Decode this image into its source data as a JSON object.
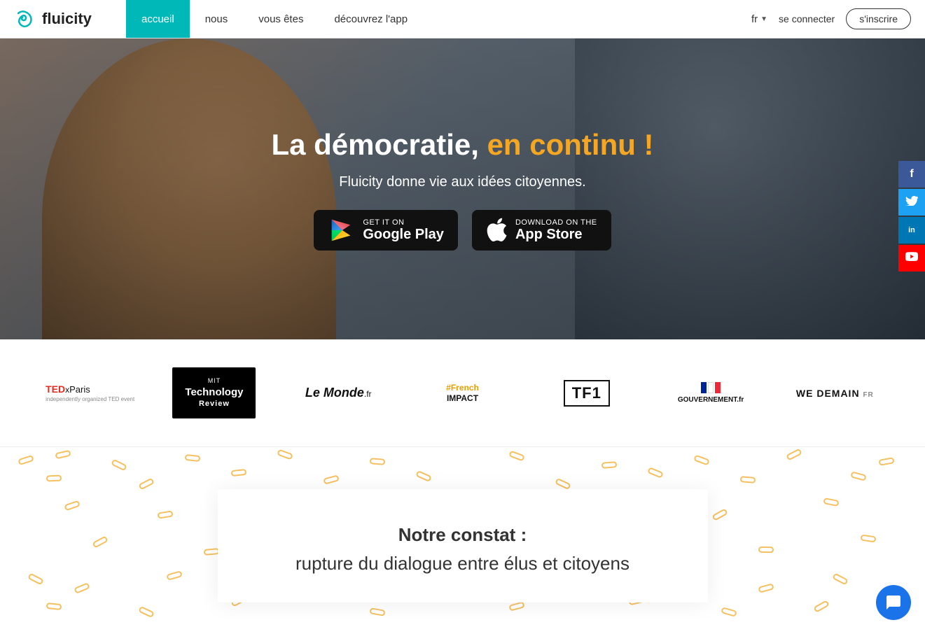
{
  "site": {
    "logo_text": "fluicity",
    "favicon_char": "F"
  },
  "navbar": {
    "links": [
      {
        "id": "accueil",
        "label": "accueil",
        "active": true
      },
      {
        "id": "nous",
        "label": "nous",
        "active": false
      },
      {
        "id": "vous-etes",
        "label": "vous êtes",
        "active": false
      },
      {
        "id": "decouvrez",
        "label": "découvrez l'app",
        "active": false
      }
    ],
    "lang": "fr",
    "lang_arrow": "▼",
    "connect_label": "se connecter",
    "register_label": "s'inscrire"
  },
  "hero": {
    "title_part1": "La démocratie, ",
    "title_highlight": "en continu !",
    "subtitle": "Fluicity donne vie aux idées citoyennes.",
    "google_play_top": "GET IT ON",
    "google_play_bottom": "Google Play",
    "app_store_top": "Download on the",
    "app_store_bottom": "App Store"
  },
  "social": {
    "facebook_char": "f",
    "twitter_char": "t",
    "linkedin_char": "in",
    "youtube_char": "▶"
  },
  "press": {
    "logos": [
      {
        "id": "tedx",
        "label": "TEDxParis",
        "type": "tedx"
      },
      {
        "id": "mit",
        "label": "MIT Technology Review",
        "type": "mit"
      },
      {
        "id": "lemonde",
        "label": "Le Monde.fr",
        "type": "lemonde"
      },
      {
        "id": "frenchimpact",
        "label": "#FrenchIMPACT",
        "type": "frenchimpact"
      },
      {
        "id": "tf1",
        "label": "TF1",
        "type": "tf1"
      },
      {
        "id": "gouvernement",
        "label": "GOUVERNEMENT.fr",
        "type": "gouv"
      },
      {
        "id": "wedemain",
        "label": "WE DEMAIN FR",
        "type": "wedemain"
      }
    ]
  },
  "bottom_section": {
    "title": "Notre constat :",
    "subtitle": "rupture du dialogue entre élus et citoyens"
  }
}
